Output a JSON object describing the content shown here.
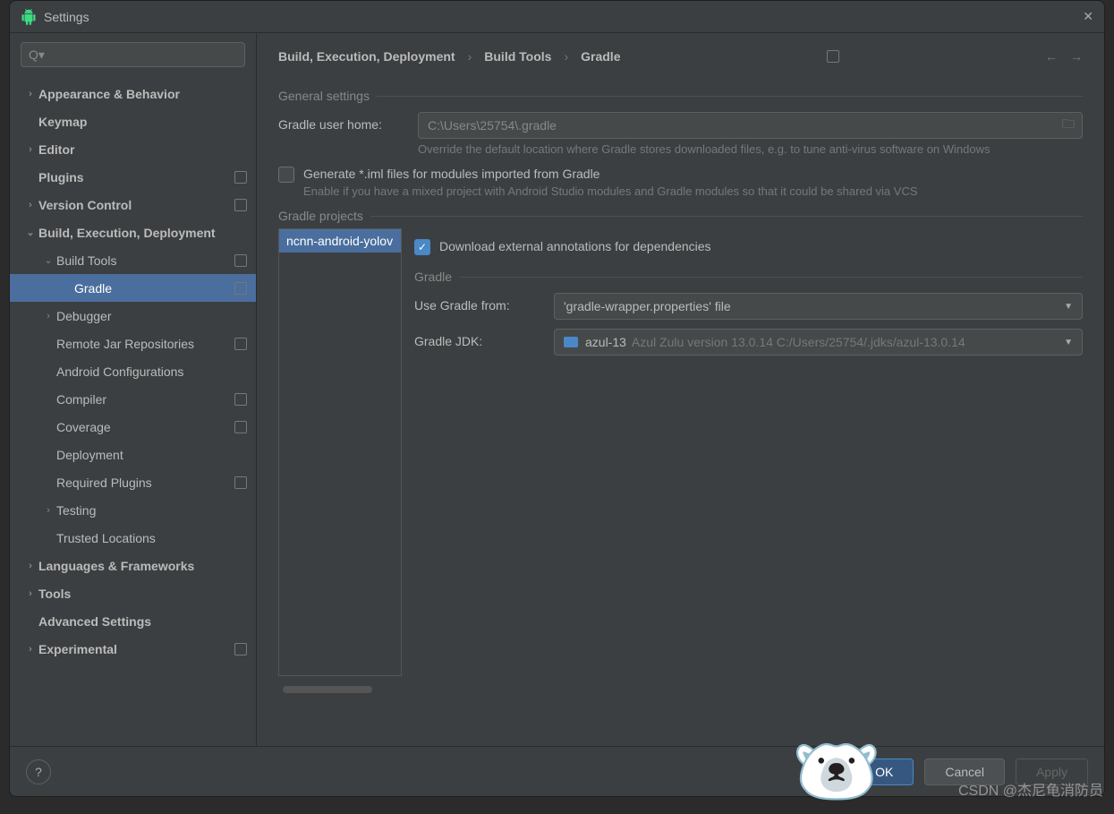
{
  "window": {
    "title": "Settings"
  },
  "search": {
    "placeholder": ""
  },
  "tree": [
    {
      "label": "Appearance & Behavior",
      "indent": 0,
      "chev": "›",
      "bold": true
    },
    {
      "label": "Keymap",
      "indent": 0,
      "chev": "",
      "bold": true
    },
    {
      "label": "Editor",
      "indent": 0,
      "chev": "›",
      "bold": true
    },
    {
      "label": "Plugins",
      "indent": 0,
      "chev": "",
      "bold": true,
      "badge": true
    },
    {
      "label": "Version Control",
      "indent": 0,
      "chev": "›",
      "bold": true,
      "badge": true
    },
    {
      "label": "Build, Execution, Deployment",
      "indent": 0,
      "chev": "⌄",
      "bold": true
    },
    {
      "label": "Build Tools",
      "indent": 1,
      "chev": "⌄",
      "badge": true
    },
    {
      "label": "Gradle",
      "indent": 2,
      "chev": "",
      "selected": true,
      "badge": true
    },
    {
      "label": "Debugger",
      "indent": 1,
      "chev": "›"
    },
    {
      "label": "Remote Jar Repositories",
      "indent": 1,
      "chev": "",
      "badge": true
    },
    {
      "label": "Android Configurations",
      "indent": 1,
      "chev": ""
    },
    {
      "label": "Compiler",
      "indent": 1,
      "chev": "",
      "badge": true
    },
    {
      "label": "Coverage",
      "indent": 1,
      "chev": "",
      "badge": true
    },
    {
      "label": "Deployment",
      "indent": 1,
      "chev": ""
    },
    {
      "label": "Required Plugins",
      "indent": 1,
      "chev": "",
      "badge": true
    },
    {
      "label": "Testing",
      "indent": 1,
      "chev": "›"
    },
    {
      "label": "Trusted Locations",
      "indent": 1,
      "chev": ""
    },
    {
      "label": "Languages & Frameworks",
      "indent": 0,
      "chev": "›",
      "bold": true
    },
    {
      "label": "Tools",
      "indent": 0,
      "chev": "›",
      "bold": true
    },
    {
      "label": "Advanced Settings",
      "indent": 0,
      "chev": "",
      "bold": true
    },
    {
      "label": "Experimental",
      "indent": 0,
      "chev": "›",
      "bold": true,
      "badge": true
    }
  ],
  "breadcrumb": {
    "a": "Build, Execution, Deployment",
    "b": "Build Tools",
    "c": "Gradle"
  },
  "general": {
    "title": "General settings",
    "home_label": "Gradle user home:",
    "home_value": "C:\\Users\\25754\\.gradle",
    "home_hint": "Override the default location where Gradle stores downloaded files, e.g. to tune anti-virus software on Windows",
    "iml_label": "Generate *.iml files for modules imported from Gradle",
    "iml_hint": "Enable if you have a mixed project with Android Studio modules and Gradle modules so that it could be shared via VCS"
  },
  "projects": {
    "title": "Gradle projects",
    "selected": "ncnn-android-yolov",
    "download_label": "Download external annotations for dependencies",
    "gradle_section": "Gradle",
    "use_from_label": "Use Gradle from:",
    "use_from_value": "'gradle-wrapper.properties' file",
    "jdk_label": "Gradle JDK:",
    "jdk_name": "azul-13",
    "jdk_path": "Azul Zulu version 13.0.14 C:/Users/25754/.jdks/azul-13.0.14"
  },
  "buttons": {
    "ok": "OK",
    "cancel": "Cancel",
    "apply": "Apply"
  },
  "watermark": "CSDN @杰尼龟消防员"
}
